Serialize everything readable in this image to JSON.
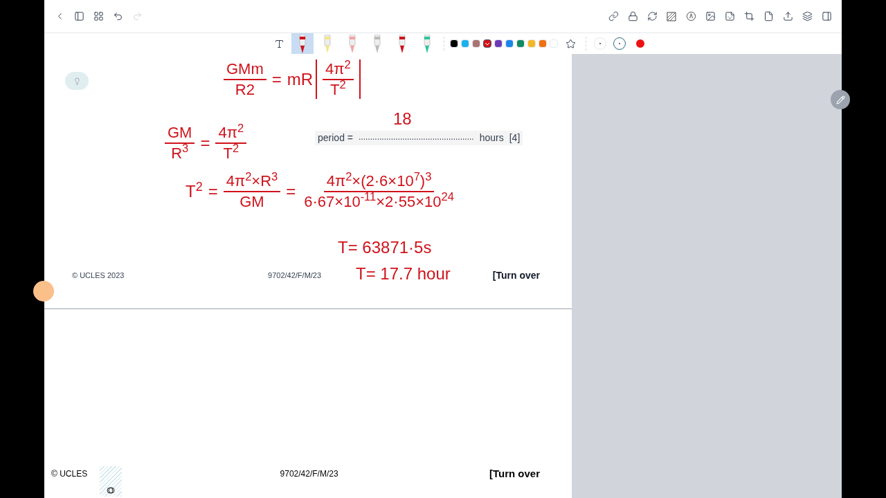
{
  "toolbar": {
    "redo": {
      "disabled": true
    }
  },
  "pen_tools": [
    {
      "kind": "fountain",
      "selected": true
    },
    {
      "kind": "highlighter",
      "selected": false
    },
    {
      "kind": "eraser",
      "selected": false
    },
    {
      "kind": "lasso",
      "selected": false
    },
    {
      "kind": "marker",
      "selected": false
    },
    {
      "kind": "ruler-pen",
      "selected": false
    }
  ],
  "colors": [
    {
      "color": "#000000",
      "selected": false
    },
    {
      "color": "#1ab0ef",
      "selected": false
    },
    {
      "color": "#a97373",
      "selected": false
    },
    {
      "color": "#d0121b",
      "selected": true
    },
    {
      "color": "#6a3bb5",
      "selected": false
    },
    {
      "color": "#1a86e8",
      "selected": false
    },
    {
      "color": "#118a63",
      "selected": false
    },
    {
      "color": "#f4b625",
      "selected": false
    },
    {
      "color": "#f07010",
      "selected": false
    },
    {
      "color": "#ffffff",
      "selected": false
    }
  ],
  "sizes": [
    {
      "selected": false
    },
    {
      "selected": true
    }
  ],
  "current_color": {
    "color": "#ee1111"
  },
  "pages": [
    {
      "footer_left": "© UCLES 2023",
      "footer_center": "9702/42/F/M/23",
      "footer_right": "[Turn over",
      "answer": {
        "label": "period =",
        "dots": "..................................................",
        "unit": "hours",
        "marks": "[4]"
      }
    },
    {
      "footer_left": "© UCLES",
      "footer_center": "9702/42/F/M/23",
      "footer_right": "[Turn over"
    }
  ],
  "ink": [
    {
      "parts": [
        {
          "kind": "frac",
          "num": "GMm",
          "den": "R2"
        },
        {
          "kind": "text",
          "text": "="
        },
        {
          "kind": "text",
          "text": "mR"
        },
        {
          "kind": "bracket",
          "num": "4π$^{2}$",
          "den": "T$^{2}$"
        }
      ]
    },
    {
      "parts": [
        {
          "kind": "frac",
          "num": "GM",
          "den": "R$^{3}$"
        },
        {
          "kind": "text",
          "text": "="
        },
        {
          "kind": "frac",
          "num": "4π$^{2}$",
          "den": "T$^{2}$"
        }
      ]
    },
    {
      "parts": [
        {
          "kind": "text",
          "text": "T$^{2}$"
        },
        {
          "kind": "text",
          "text": "="
        },
        {
          "kind": "frac",
          "num": "4π$^{2}$×R$^{3}$",
          "den": "GM"
        },
        {
          "kind": "text",
          "text": "="
        },
        {
          "kind": "frac",
          "num": "4π$^{2}$×(2·6×10$^{7}$)$^{3}$",
          "den": "6·67×10$^{-11}$×2·55×10$^{24}$"
        }
      ]
    },
    {
      "parts": [
        {
          "kind": "text",
          "text": "18"
        }
      ]
    },
    {
      "parts": [
        {
          "kind": "text",
          "text": "T= 63871·5s"
        }
      ]
    },
    {
      "parts": [
        {
          "kind": "text",
          "text": "T= 17.7 hour"
        }
      ]
    }
  ]
}
